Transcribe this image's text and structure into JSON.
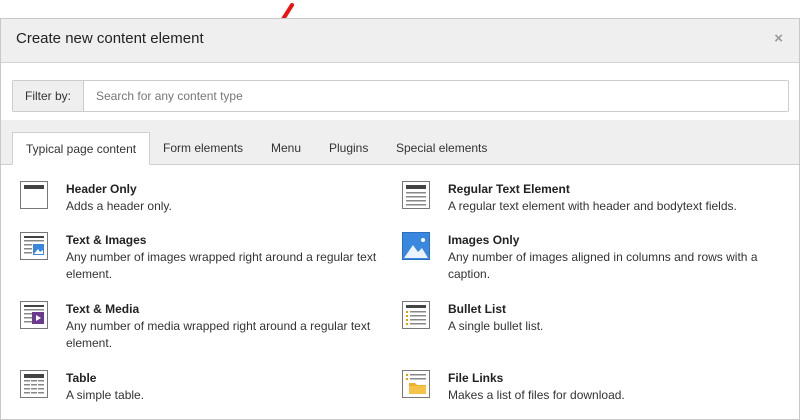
{
  "dialog": {
    "title": "Create new content element",
    "close_label": "×"
  },
  "filter": {
    "label": "Filter by:",
    "placeholder": "Search for any content type"
  },
  "tabs": [
    {
      "label": "Typical page content",
      "active": true
    },
    {
      "label": "Form elements"
    },
    {
      "label": "Menu"
    },
    {
      "label": "Plugins"
    },
    {
      "label": "Special elements"
    }
  ],
  "items": [
    {
      "title": "Header Only",
      "desc": "Adds a header only.",
      "icon": "header-only-icon"
    },
    {
      "title": "Regular Text Element",
      "desc": "A regular text element with header and bodytext fields.",
      "icon": "regular-text-icon"
    },
    {
      "title": "Text & Images",
      "desc": "Any number of images wrapped right around a regular text element.",
      "icon": "text-images-icon"
    },
    {
      "title": "Images Only",
      "desc": "Any number of images aligned in columns and rows with a caption.",
      "icon": "images-only-icon"
    },
    {
      "title": "Text & Media",
      "desc": "Any number of media wrapped right around a regular text element.",
      "icon": "text-media-icon"
    },
    {
      "title": "Bullet List",
      "desc": "A single bullet list.",
      "icon": "bullet-list-icon"
    },
    {
      "title": "Table",
      "desc": "A simple table.",
      "icon": "table-icon"
    },
    {
      "title": "File Links",
      "desc": "Makes a list of files for download.",
      "icon": "file-links-icon"
    }
  ],
  "colors": {
    "accent_arrow": "#ee1111",
    "image_blue": "#3a87e0",
    "media_purple": "#6b3a8e"
  }
}
